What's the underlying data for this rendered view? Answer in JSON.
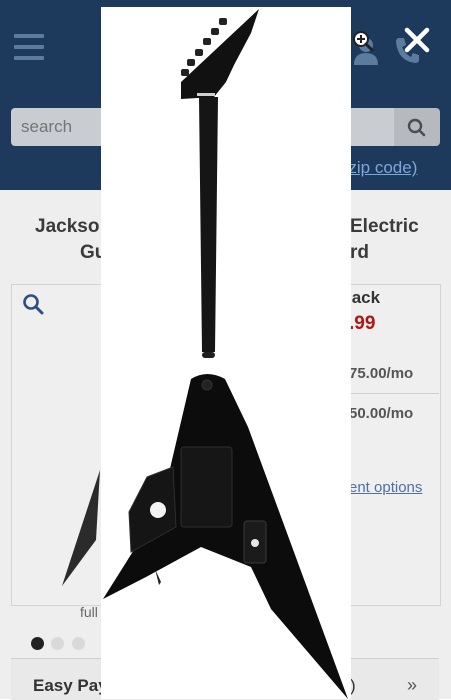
{
  "header": {
    "menu_icon": "hamburger-menu-icon",
    "account_icon": "user-icon",
    "phone_icon": "phone-icon"
  },
  "search": {
    "placeholder": "search",
    "button_icon": "search-icon",
    "zip_link_visible": "r zip code)"
  },
  "product": {
    "title_left_line1": "Jackso",
    "title_left_line2": "Gu",
    "title_right_line1": "Electric",
    "title_right_line2": "rd",
    "finish_visible": "lack",
    "price_visible": ".99",
    "financing_1": "75.00/mo",
    "financing_2": "50.00/mo",
    "payment_options_link": "ent options",
    "full_label": "full",
    "gallery_dots": 5,
    "gallery_active_dot": 0,
    "easy_pay_label": "Easy Pay",
    "easy_pay_suffix": ")",
    "chevron": "»"
  },
  "modal": {
    "image_name": "guitar-back-image",
    "close_icon": "close-icon",
    "zoom_icon": "zoom-in-icon"
  },
  "colors": {
    "header_bg": "#1d3a5c",
    "price_red": "#b01414",
    "link_blue": "#4f6fa8"
  }
}
